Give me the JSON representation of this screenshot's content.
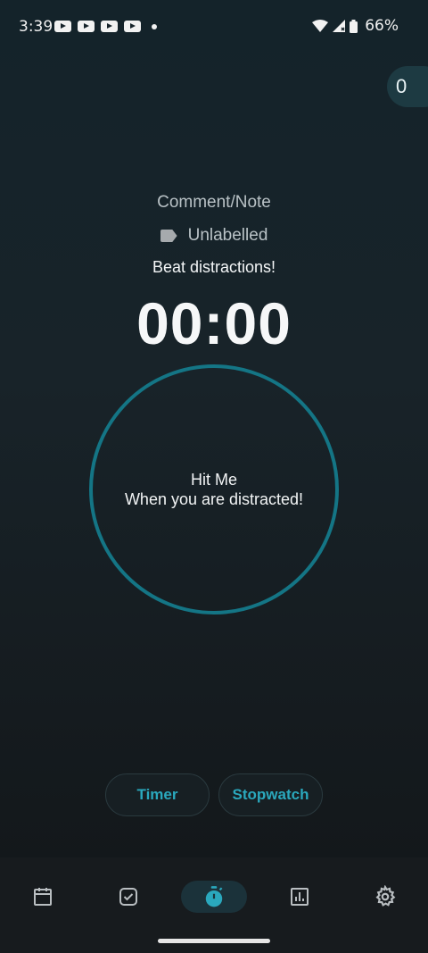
{
  "status_bar": {
    "time": "3:39",
    "notification_icons": [
      "youtube-icon",
      "youtube-icon",
      "youtube-icon",
      "youtube-icon"
    ],
    "battery": "66%"
  },
  "counter": "0",
  "comment_placeholder": "Comment/Note",
  "label": "Unlabelled",
  "motivation": "Beat distractions!",
  "timer": "00:00",
  "hit_button": {
    "line1": "Hit Me",
    "line2": "When you are distracted!"
  },
  "modes": {
    "timer_label": "Timer",
    "stopwatch_label": "Stopwatch"
  },
  "nav": {
    "items": [
      "calendar-icon",
      "checkbox-icon",
      "stopwatch-icon",
      "bar-chart-icon",
      "settings-icon"
    ],
    "active": "stopwatch-icon"
  },
  "colors": {
    "accent": "#2aa8bd",
    "ring": "#147585"
  }
}
